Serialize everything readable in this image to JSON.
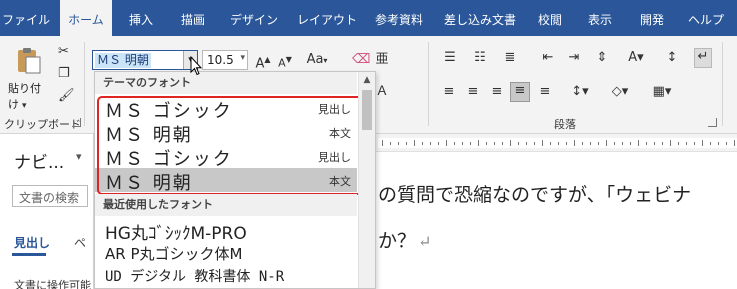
{
  "ribbon": {
    "tabs": [
      "ファイル",
      "ホーム",
      "挿入",
      "描画",
      "デザイン",
      "レイアウト",
      "参考資料",
      "差し込み文書",
      "校閲",
      "表示",
      "開発",
      "ヘルプ"
    ],
    "active_tab": "ホーム",
    "clipboard": {
      "paste_label": "貼り付け",
      "group_label": "クリップボード"
    },
    "font": {
      "name_value": "ＭＳ 明朝",
      "size_value": "10.5"
    },
    "paragraph": {
      "group_label": "段落"
    },
    "colors": {
      "tab_bar": "#2b579a",
      "ribbon_bg": "#f3f3f3"
    }
  },
  "font_dropdown": {
    "theme_header": "テーマのフォント",
    "theme_fonts": [
      {
        "name": "ＭＳ ゴシック",
        "tag": "見出し"
      },
      {
        "name": "ＭＳ 明朝",
        "tag": "本文"
      },
      {
        "name": "ＭＳ ゴシック",
        "tag": "見出し"
      },
      {
        "name": "ＭＳ 明朝",
        "tag": "本文"
      }
    ],
    "recent_header": "最近使用したフォント",
    "recent_fonts": [
      "HG丸ｺﾞｼｯｸM-PRO",
      "AR P丸ゴシック体M",
      "UD デジタル 教科書体 N-R"
    ],
    "highlight_color": "#e02424"
  },
  "navigation": {
    "title": "ナビ...",
    "search_placeholder": "文書の検索",
    "tabs": [
      "見出し",
      "ペ"
    ],
    "hint_text": "文書に操作可能"
  },
  "document": {
    "line1": "の質問で恐縮なのですが、「ウェビナ",
    "line2": "か？",
    "para_mark": "↵"
  }
}
